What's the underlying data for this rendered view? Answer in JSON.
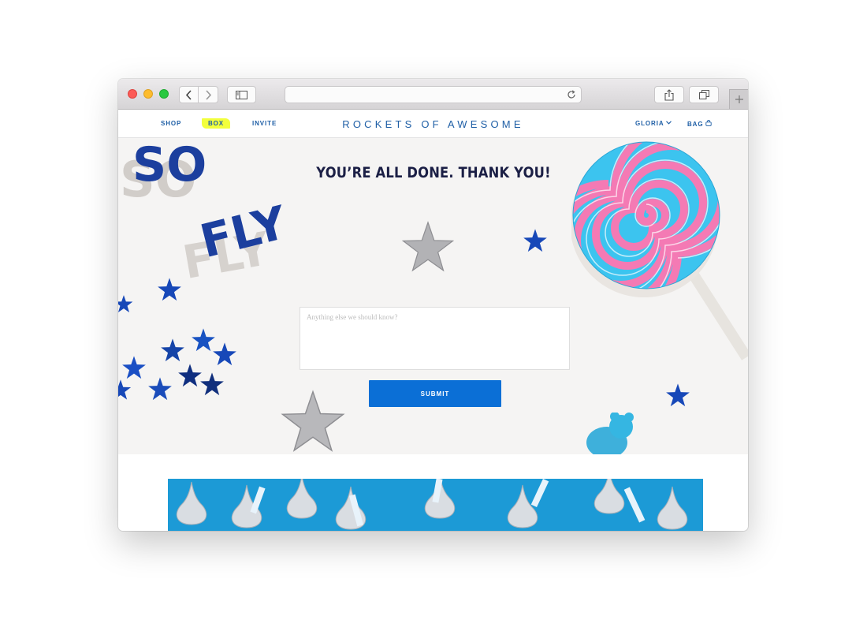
{
  "site": {
    "brand": "ROCKETS OF AWESOME",
    "nav_left": {
      "shop": "SHOP",
      "box": "BOX",
      "invite": "INVITE"
    },
    "nav_right": {
      "account": "GLORIA",
      "bag": "BAG"
    }
  },
  "hero": {
    "headline": "YOU’RE ALL DONE. THANK YOU!",
    "word_so": "SO",
    "word_fly": "FLY"
  },
  "form": {
    "feedback_placeholder": "Anything else we should know?",
    "submit_label": "SUBMIT"
  },
  "colors": {
    "brand_blue": "#1f5fa6",
    "submit_blue": "#0b6fd6",
    "box_highlight": "#f2ff3c",
    "hero_bg": "#f5f4f3",
    "headline": "#1b1f45"
  }
}
